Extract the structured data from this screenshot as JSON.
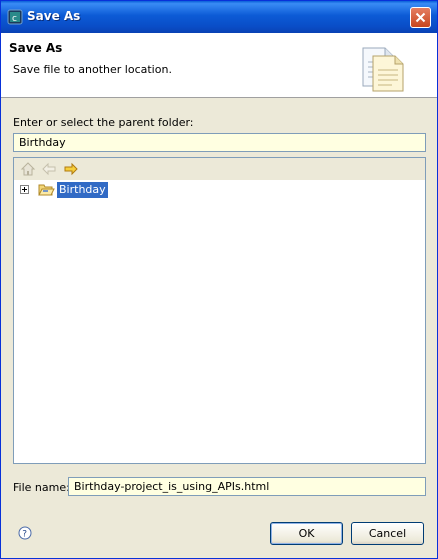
{
  "window": {
    "title": "Save As"
  },
  "header": {
    "title": "Save As",
    "message": "Save file to another location."
  },
  "parent_folder": {
    "label": "Enter or select the parent folder:",
    "value": "Birthday"
  },
  "tree": {
    "items": [
      {
        "label": "Birthday",
        "selected": true,
        "expanded": false
      }
    ]
  },
  "file_name": {
    "label": "File name:",
    "value": "Birthday-project_is_using_APIs.html"
  },
  "buttons": {
    "ok": "OK",
    "cancel": "Cancel"
  },
  "colors": {
    "title_bar": "#0a4dc7",
    "selection": "#316ac5",
    "input_bg": "#ffffe1",
    "dialog_bg": "#ece9d8"
  },
  "icons": {
    "home": "home-icon",
    "back": "back-arrow-icon",
    "forward": "forward-arrow-icon",
    "help": "help-icon",
    "folder": "open-folder-icon"
  }
}
